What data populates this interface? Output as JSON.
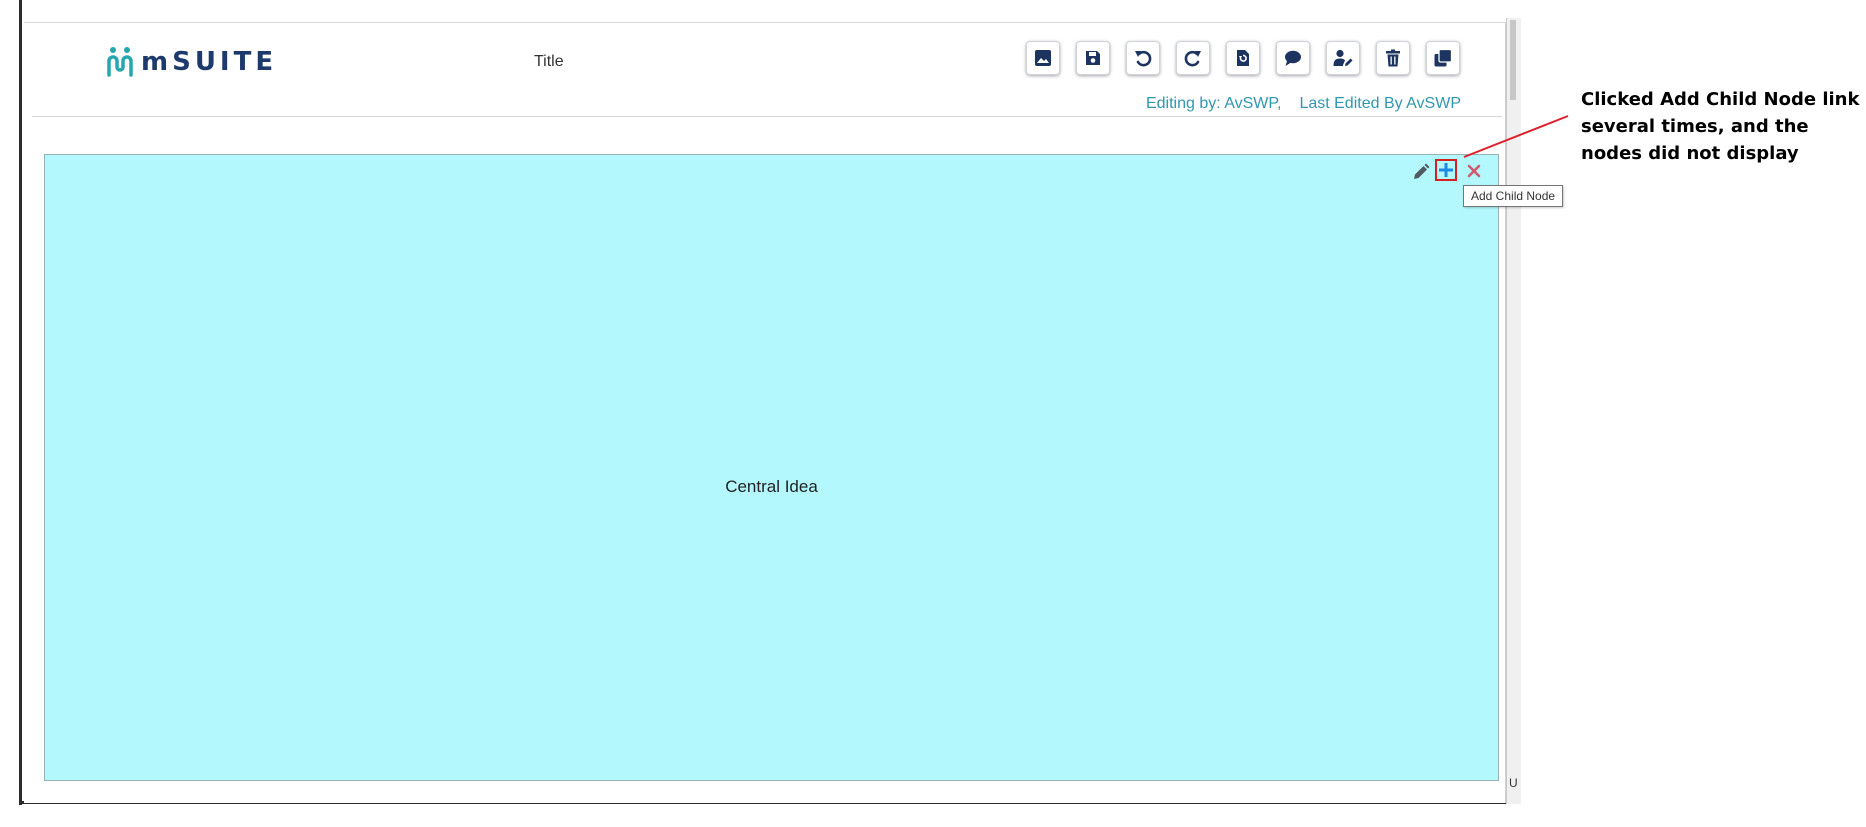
{
  "header": {
    "logo_text": "mSUITE",
    "title": "Title",
    "editing_by": "Editing by: AvSWP,",
    "last_edited_by": "Last Edited By AvSWP"
  },
  "toolbar": [
    {
      "name": "image-button",
      "icon": "image-icon"
    },
    {
      "name": "save-button",
      "icon": "save-icon"
    },
    {
      "name": "undo-button",
      "icon": "undo-icon"
    },
    {
      "name": "redo-button",
      "icon": "redo-icon"
    },
    {
      "name": "restore-button",
      "icon": "file-restore-icon"
    },
    {
      "name": "comment-button",
      "icon": "comment-icon"
    },
    {
      "name": "edit-user-button",
      "icon": "user-edit-icon"
    },
    {
      "name": "delete-button",
      "icon": "trash-icon"
    },
    {
      "name": "copy-button",
      "icon": "copy-icon"
    }
  ],
  "canvas": {
    "central_node_label": "Central Idea",
    "node_tools": [
      "pencil-icon",
      "plus-icon",
      "close-icon"
    ],
    "tooltip": "Add Child Node"
  },
  "annotation": {
    "text": "Clicked Add Child Node link several times, and the nodes did not display"
  },
  "side_strip_letter": "U",
  "colors": {
    "brand_navy": "#1c3a6b",
    "brand_teal": "#26a6b0",
    "canvas_bg": "#b3f8fc",
    "status_text": "#2f98b0",
    "icon_navy": "#1d3461",
    "add_icon": "#1e88e5",
    "close_icon": "#d35a6e",
    "highlight_red": "#d42020"
  }
}
